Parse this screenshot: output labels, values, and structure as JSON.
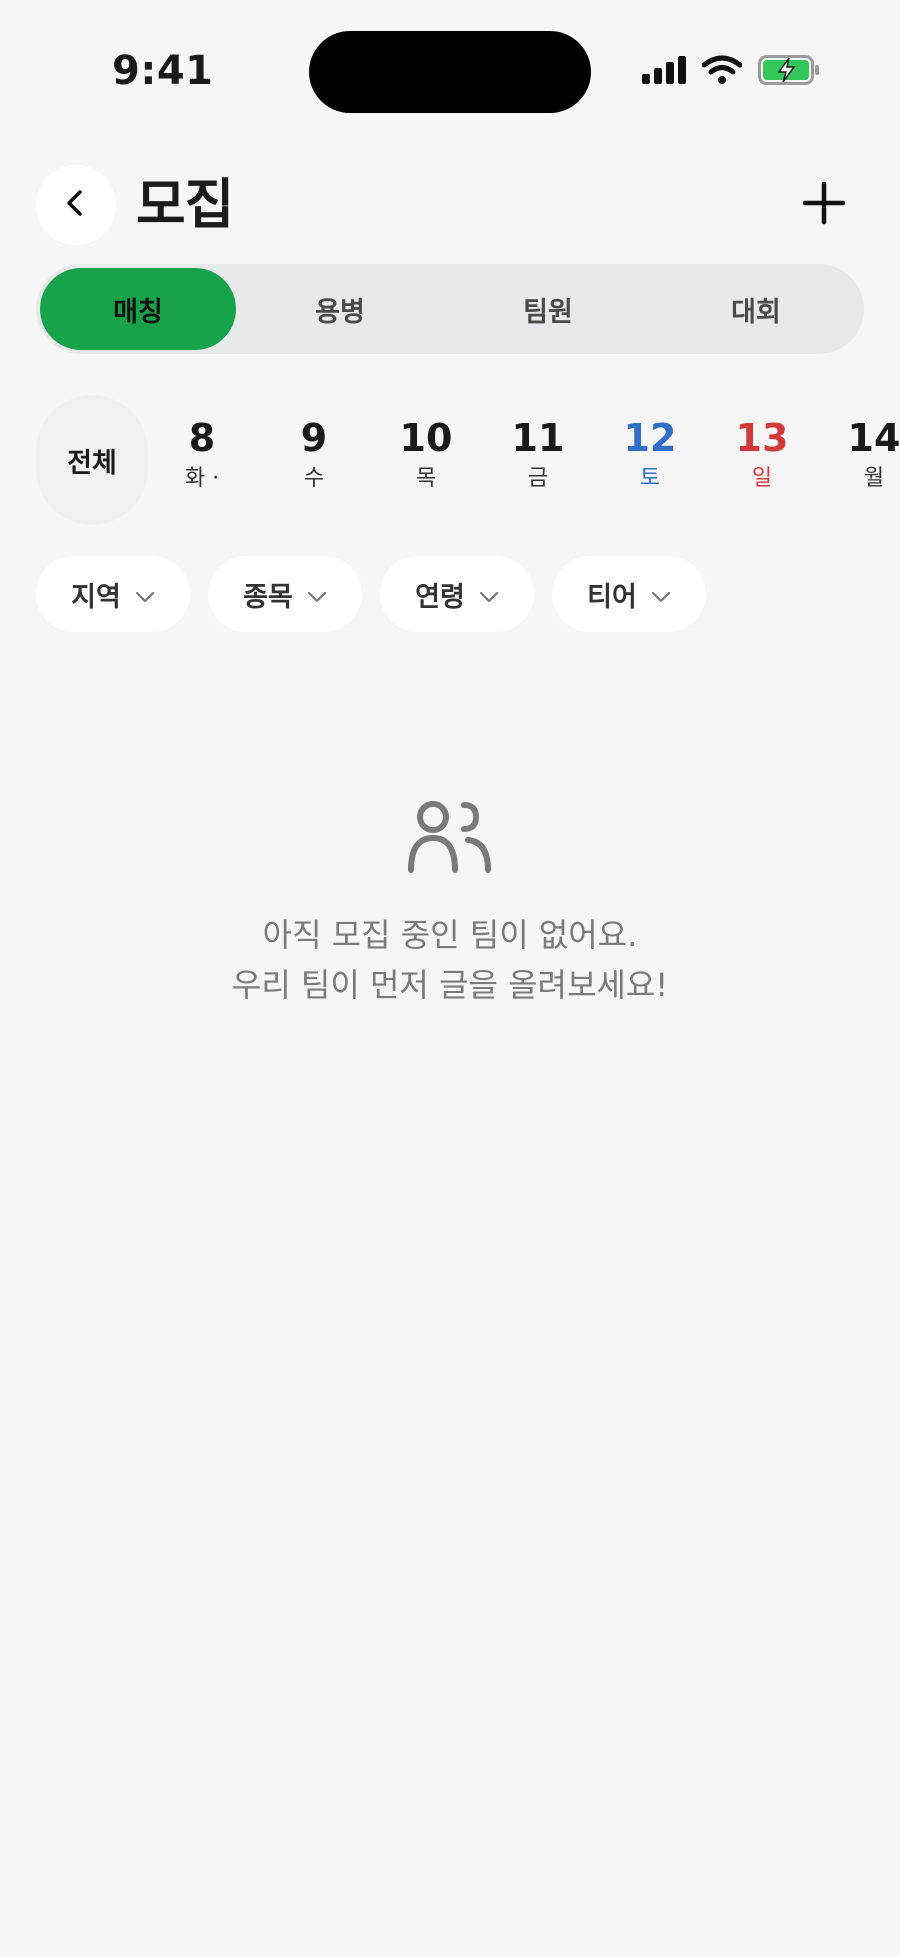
{
  "status_bar": {
    "time": "9:41"
  },
  "header": {
    "title": "모집",
    "back_icon": "chevron-left-icon",
    "add_icon": "plus-icon"
  },
  "tabs": [
    {
      "label": "매칭",
      "active": true
    },
    {
      "label": "용병",
      "active": false
    },
    {
      "label": "팀원",
      "active": false
    },
    {
      "label": "대회",
      "active": false
    }
  ],
  "dates": {
    "all_label": "전체",
    "items": [
      {
        "day": "8",
        "weekday": "화 ·",
        "type": "weekday"
      },
      {
        "day": "9",
        "weekday": "수",
        "type": "weekday"
      },
      {
        "day": "10",
        "weekday": "목",
        "type": "weekday"
      },
      {
        "day": "11",
        "weekday": "금",
        "type": "weekday"
      },
      {
        "day": "12",
        "weekday": "토",
        "type": "sat"
      },
      {
        "day": "13",
        "weekday": "일",
        "type": "sun"
      },
      {
        "day": "14",
        "weekday": "월",
        "type": "weekday"
      }
    ]
  },
  "filters": [
    {
      "label": "지역"
    },
    {
      "label": "종목"
    },
    {
      "label": "연령"
    },
    {
      "label": "티어"
    }
  ],
  "empty_state": {
    "icon": "users-icon",
    "line1": "아직 모집 중인 팀이 없어요.",
    "line2": "우리 팀이 먼저 글을 올려보세요!"
  },
  "colors": {
    "accent": "#16a34a",
    "saturday": "#2f6fc7",
    "sunday": "#d23a3a",
    "background": "#f6f6f6"
  }
}
